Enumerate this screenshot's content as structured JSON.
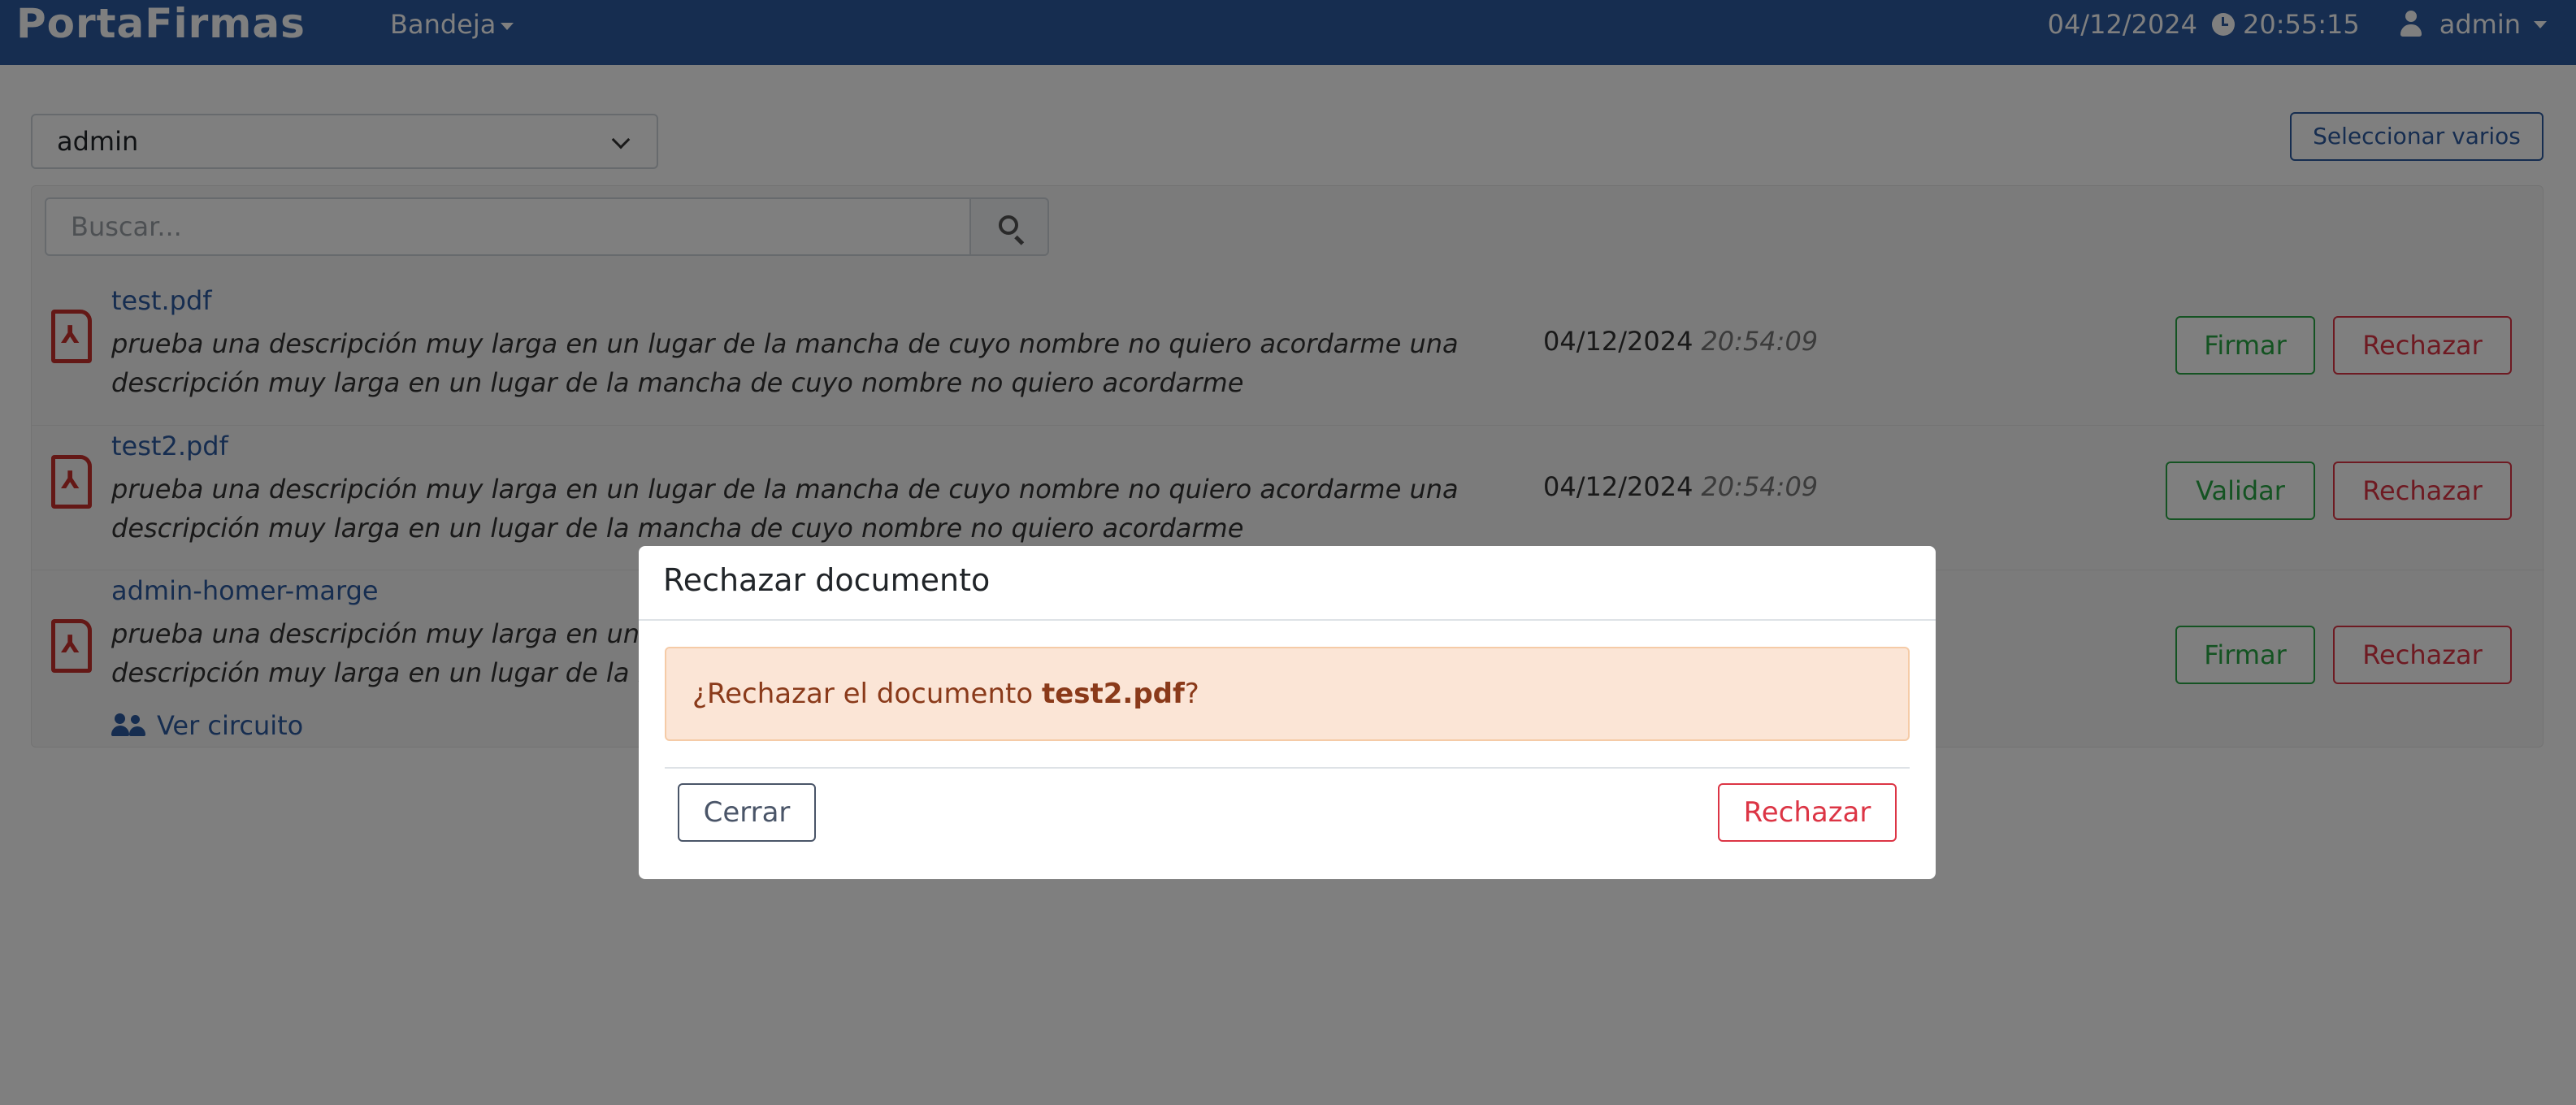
{
  "navbar": {
    "brand": "PortaFirmas",
    "menu_label": "Bandeja",
    "date": "04/12/2024",
    "time": "20:55:15",
    "user": "admin",
    "color": "#2c5aa0"
  },
  "toolbar": {
    "user_select_value": "admin",
    "select_many_label": "Seleccionar varios"
  },
  "search": {
    "placeholder": "Buscar..."
  },
  "documents": [
    {
      "name": "test.pdf",
      "description": "prueba una descripción muy larga en un lugar de la mancha de cuyo nombre no quiero acordarme una descripción muy larga en un lugar de la mancha de cuyo nombre no quiero acordarme",
      "date": "04/12/2024",
      "time": "20:54:09",
      "action_label": "Firmar",
      "reject_label": "Rechazar"
    },
    {
      "name": "test2.pdf",
      "description": "prueba una descripción muy larga en un lugar de la mancha de cuyo nombre no quiero acordarme una descripción muy larga en un lugar de la mancha de cuyo nombre no quiero acordarme",
      "date": "04/12/2024",
      "time": "20:54:09",
      "action_label": "Validar",
      "reject_label": "Rechazar"
    },
    {
      "name": "admin-homer-marge",
      "description": "prueba una descripción muy larga en un lugar de la mancha de cuyo nombre no quiero acordarme una descripción muy larga en un lugar de la mancha de cuyo nombre no quiero acordarme",
      "circuit_label": "Ver circuito",
      "action_label": "Firmar",
      "reject_label": "Rechazar"
    }
  ],
  "modal": {
    "title": "Rechazar documento",
    "message_prefix": "¿Rechazar el documento ",
    "message_document": "test2.pdf",
    "message_suffix": "?",
    "close_label": "Cerrar",
    "reject_label": "Rechazar"
  }
}
